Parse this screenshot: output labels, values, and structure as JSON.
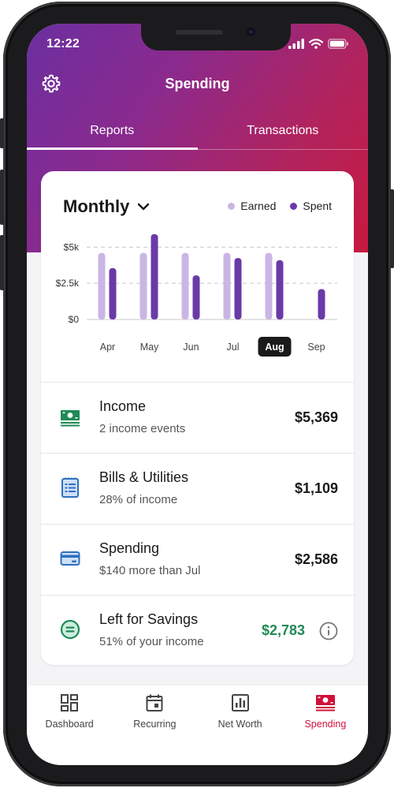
{
  "status_bar": {
    "time": "12:22"
  },
  "header": {
    "title": "Spending"
  },
  "tabs": [
    {
      "label": "Reports",
      "active": true
    },
    {
      "label": "Transactions",
      "active": false
    }
  ],
  "report": {
    "period_label": "Monthly",
    "legend": {
      "earned": "Earned",
      "spent": "Spent"
    },
    "selected_month": "Aug"
  },
  "colors": {
    "earned": "#c9b6e4",
    "spent": "#6a3aa8",
    "accent": "#d0103a",
    "positive": "#1f8a55"
  },
  "chart_data": {
    "type": "bar",
    "categories": [
      "Apr",
      "May",
      "Jun",
      "Jul",
      "Aug",
      "Sep"
    ],
    "series": [
      {
        "name": "Earned",
        "values": [
          4600,
          4600,
          4600,
          4600,
          4600,
          0
        ]
      },
      {
        "name": "Spent",
        "values": [
          3550,
          5900,
          3050,
          4250,
          4100,
          2100
        ]
      }
    ],
    "yticks": [
      "$0",
      "$2.5k",
      "$5k"
    ],
    "ylim": [
      0,
      6000
    ],
    "grid": true,
    "legend_position": "top-right",
    "highlight_category": "Aug"
  },
  "summary": [
    {
      "icon": "money-icon",
      "title": "Income",
      "subtitle": "2 income events",
      "amount": "$5,369"
    },
    {
      "icon": "bill-icon",
      "title": "Bills & Utilities",
      "subtitle": "28% of income",
      "amount": "$1,109"
    },
    {
      "icon": "card-icon",
      "title": "Spending",
      "subtitle": "$140 more than Jul",
      "amount": "$2,586"
    },
    {
      "icon": "savings-icon",
      "title": "Left for Savings",
      "subtitle": "51% of your income",
      "amount": "$2,783"
    }
  ],
  "bottom_nav": [
    {
      "label": "Dashboard",
      "icon": "dashboard-icon",
      "active": false
    },
    {
      "label": "Recurring",
      "icon": "calendar-icon",
      "active": false
    },
    {
      "label": "Net Worth",
      "icon": "bar-chart-icon",
      "active": false
    },
    {
      "label": "Spending",
      "icon": "money-icon",
      "active": true
    }
  ]
}
